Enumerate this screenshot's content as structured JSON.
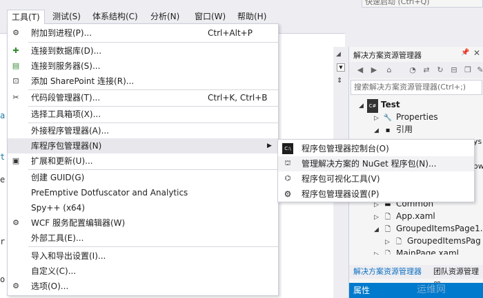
{
  "quick_launch": "快速启动 (Ctrl+Q)",
  "menubar": {
    "tools": "工具(T)",
    "test": "测试(S)",
    "arch": "体系结构(C)",
    "analyze": "分析(N)",
    "window": "窗口(W)",
    "help": "帮助(H)"
  },
  "editor": {
    "frag1": "a",
    "frag2": "t",
    "frag3": "e",
    "frag4": "r",
    "frag5": "o"
  },
  "tools_menu": {
    "items": [
      {
        "label": "附加到进程(P)...",
        "shortcut": "Ctrl+Alt+P",
        "icon": "attach-process-icon"
      },
      {
        "label": "连接到数据库(D)...",
        "shortcut": "",
        "icon": "connect-database-icon"
      },
      {
        "label": "连接到服务器(S)...",
        "shortcut": "",
        "icon": "connect-server-icon"
      },
      {
        "label": "添加 SharePoint 连接(R)...",
        "shortcut": "",
        "icon": "sharepoint-icon"
      },
      {
        "label": "代码段管理器(T)...",
        "shortcut": "Ctrl+K, Ctrl+B",
        "icon": "snippet-icon"
      },
      {
        "label": "选择工具箱项(X)...",
        "shortcut": "",
        "icon": ""
      },
      {
        "label": "外接程序管理器(A)...",
        "shortcut": "",
        "icon": ""
      },
      {
        "label": "库程序包管理器(N)",
        "shortcut": "",
        "icon": ""
      },
      {
        "label": "扩展和更新(U)...",
        "shortcut": "",
        "icon": "extensions-icon"
      },
      {
        "label": "创建 GUID(G)",
        "shortcut": "",
        "icon": ""
      },
      {
        "label": "PreEmptive Dotfuscator and Analytics",
        "shortcut": "",
        "icon": ""
      },
      {
        "label": "Spy++ (x64)",
        "shortcut": "",
        "icon": ""
      },
      {
        "label": "WCF 服务配置编辑器(W)",
        "shortcut": "",
        "icon": "wcf-gear-icon"
      },
      {
        "label": "外部工具(E)...",
        "shortcut": "",
        "icon": ""
      },
      {
        "label": "导入和导出设置(I)...",
        "shortcut": "",
        "icon": ""
      },
      {
        "label": "自定义(C)...",
        "shortcut": "",
        "icon": ""
      },
      {
        "label": "选项(O)...",
        "shortcut": "",
        "icon": "gear-icon"
      }
    ]
  },
  "nuget_submenu": {
    "items": [
      {
        "label": "程序包管理器控制台(O)",
        "icon": "console-icon"
      },
      {
        "label": "管理解决方案的 NuGet 程序包(N)...",
        "icon": "package-icon"
      },
      {
        "label": "程序包可视化工具(V)",
        "icon": "visualizer-icon"
      },
      {
        "label": "程序包管理器设置(P)",
        "icon": "gear-icon"
      }
    ]
  },
  "solution_explorer": {
    "title": "解决方案资源管理器",
    "search_placeholder": "搜索解决方案资源管理器(Ctrl+;)",
    "tree": {
      "project": "Test",
      "properties": "Properties",
      "references": "引用",
      "ys_fragment": "ys",
      "ow_fragment": "ow",
      "common": "Common",
      "app": "App.xaml",
      "grouped1": "GroupedItemsPage1.",
      "grouped2": "GroupedItemsPag",
      "main": "MainPage.xaml"
    },
    "tab_active": "解决方案资源管理器",
    "tab_other": "团队资源管理器",
    "properties_bar": "属性"
  },
  "watermark": "运维网",
  "colors": {
    "accent": "#007acc",
    "menu_highlight": "#e8e8ec",
    "border": "#cccedb"
  }
}
